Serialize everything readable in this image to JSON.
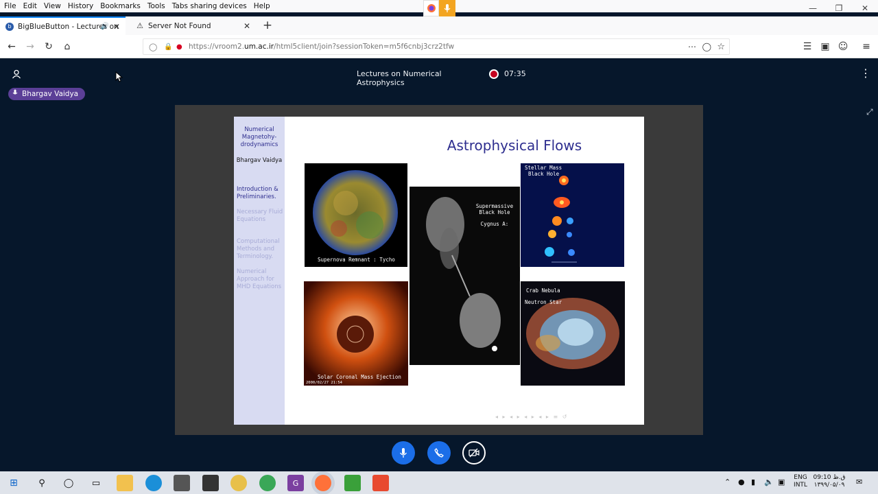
{
  "menubar": {
    "items": [
      "File",
      "Edit",
      "View",
      "History",
      "Bookmarks",
      "Tools",
      "Tabs sharing devices",
      "Help"
    ]
  },
  "tabs": [
    {
      "title": "BigBlueButton - Lectures on",
      "icon": "bbb-icon",
      "active": true
    },
    {
      "title": "Server Not Found",
      "icon": "warning-icon",
      "active": false
    }
  ],
  "navbar": {
    "url_prefix": "https://vroom2.",
    "url_domain": "um.ac.ir",
    "url_rest": "/html5client/join?sessionToken=m5f6cnbj3crz2tfw"
  },
  "meeting": {
    "title": "Lectures on Numerical Astrophysics",
    "recording_time": "07:35"
  },
  "presenter": {
    "name": "Bhargav Vaidya"
  },
  "slide": {
    "title": "Astrophysical Flows",
    "sidebar": {
      "heading": "Numerical Magnetohy-drodynamics",
      "author": "Bhargav Vaidya",
      "sections": [
        {
          "label": "Introduction & Preliminaries.",
          "active": true
        },
        {
          "label": "Necessary Fluid Equations",
          "active": false
        },
        {
          "label": "Computational Methods and Terminology.",
          "active": false
        },
        {
          "label": "Numerical Approach for MHD Equations",
          "active": false
        }
      ]
    },
    "images": {
      "tycho": "Supernova Remnant : Tycho",
      "cygnus": [
        "Supermassive",
        "Black Hole",
        "Cygnus A:"
      ],
      "stellar": [
        "Stellar Mass",
        "Black Hole"
      ],
      "crab": [
        "Crab Nebula",
        "Neutron Star"
      ],
      "solar": "Solar Coronal Mass Ejection",
      "solar_date": "2000/02/27 21:54"
    }
  },
  "taskbar": {
    "lang": [
      "ENG",
      "INTL"
    ],
    "time": [
      "09:10 ق.ظ",
      "۱۳۹۹/۰۵/۰۹"
    ]
  },
  "colors": {
    "bbb_bg": "#06172b",
    "accent": "#1b6ee8",
    "record": "#c5021f",
    "slide_title": "#2e2e8f"
  }
}
